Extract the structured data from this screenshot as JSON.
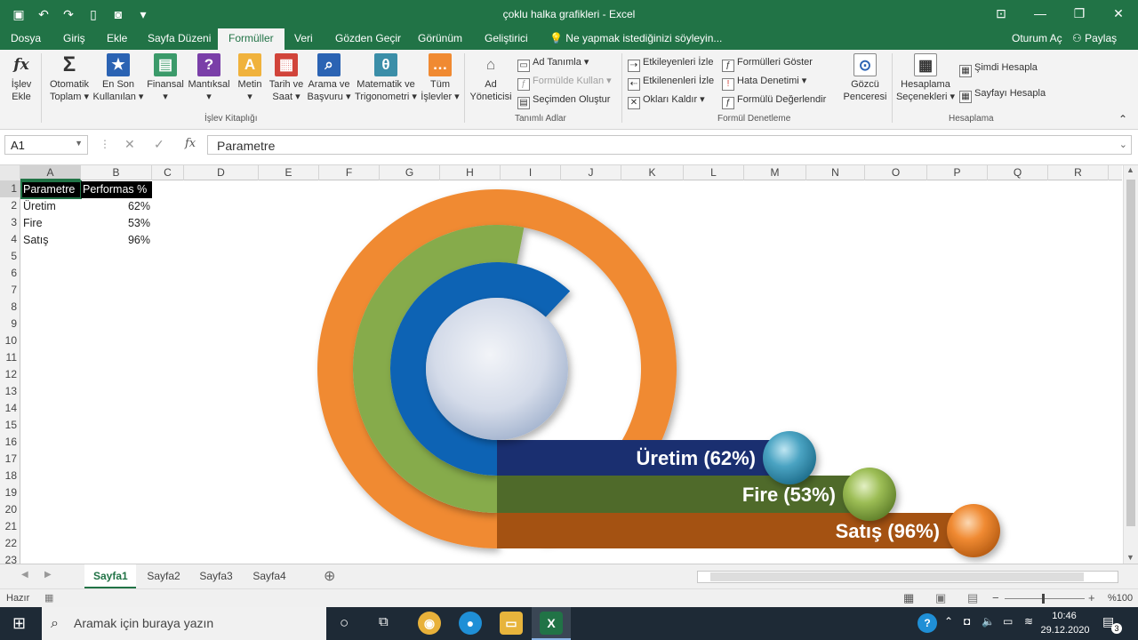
{
  "window": {
    "title": "çoklu halka grafikleri - Excel"
  },
  "tabs": [
    "Dosya",
    "Giriş",
    "Ekle",
    "Sayfa Düzeni",
    "Formüller",
    "Veri",
    "Gözden Geçir",
    "Görünüm",
    "Geliştirici"
  ],
  "tell_me": "Ne yapmak istediğinizi söyleyin...",
  "account": {
    "signin": "Oturum Aç",
    "share": "Paylaş"
  },
  "ribbon": {
    "big_buttons": [
      {
        "l1": "İşlev",
        "l2": "Ekle",
        "icon": "insert-function-icon"
      },
      {
        "l1": "Otomatik",
        "l2": "Toplam ▾",
        "icon": "autosum-icon"
      },
      {
        "l1": "En Son",
        "l2": "Kullanılan ▾",
        "icon": "recently-used-icon"
      },
      {
        "l1": "Finansal",
        "l2": "▾",
        "icon": "financial-icon"
      },
      {
        "l1": "Mantıksal",
        "l2": "▾",
        "icon": "logical-icon"
      },
      {
        "l1": "Metin",
        "l2": "▾",
        "icon": "text-icon"
      },
      {
        "l1": "Tarih ve",
        "l2": "Saat ▾",
        "icon": "date-time-icon"
      },
      {
        "l1": "Arama ve",
        "l2": "Başvuru ▾",
        "icon": "lookup-reference-icon"
      },
      {
        "l1": "Matematik ve",
        "l2": "Trigonometri ▾",
        "icon": "math-trig-icon"
      },
      {
        "l1": "Tüm",
        "l2": "İşlevler ▾",
        "icon": "more-functions-icon"
      },
      {
        "l1": "Ad",
        "l2": "Yöneticisi",
        "icon": "name-manager-icon"
      },
      {
        "l1": "Gözcü",
        "l2": "Penceresi",
        "icon": "watch-window-icon"
      },
      {
        "l1": "Hesaplama",
        "l2": "Seçenekleri ▾",
        "icon": "calculation-options-icon"
      }
    ],
    "defined_names": {
      "define": "Ad Tanımla ▾",
      "use": "Formülde Kullan ▾",
      "create": "Seçimden Oluştur"
    },
    "auditing": {
      "trace_prec": "Etkileyenleri İzle",
      "trace_dep": "Etkilenenleri İzle",
      "remove": "Okları Kaldır ▾",
      "show": "Formülleri Göster",
      "error": "Hata Denetimi ▾",
      "evaluate": "Formülü Değerlendir"
    },
    "calc": {
      "now": "Şimdi Hesapla",
      "sheet": "Sayfayı Hesapla"
    },
    "groups": {
      "library": "İşlev Kitaplığı",
      "names": "Tanımlı Adlar",
      "auditing": "Formül Denetleme",
      "calculation": "Hesaplama"
    }
  },
  "formula_bar": {
    "name_box": "A1",
    "fx": "fx",
    "content": "Parametre"
  },
  "columns": [
    "A",
    "B",
    "C",
    "D",
    "E",
    "F",
    "G",
    "H",
    "I",
    "J",
    "K",
    "L",
    "M",
    "N",
    "O",
    "P",
    "Q",
    "R"
  ],
  "rows": [
    "1",
    "2",
    "3",
    "4",
    "5",
    "6",
    "7",
    "8",
    "9",
    "10",
    "11",
    "12",
    "13",
    "14",
    "15",
    "16",
    "17",
    "18",
    "19",
    "20",
    "21",
    "22",
    "23"
  ],
  "cells": {
    "header": [
      "Parametre",
      "Performas %"
    ],
    "data": [
      [
        "Üretim",
        "62%"
      ],
      [
        "Fire",
        "53%"
      ],
      [
        "Satış",
        "96%"
      ]
    ]
  },
  "chart_data": {
    "type": "radial-bar",
    "categories": [
      "Üretim",
      "Fire",
      "Satış"
    ],
    "values": [
      62,
      53,
      96
    ],
    "labels": [
      "Üretim (62%)",
      "Fire (53%)",
      "Satış (96%)"
    ],
    "colors": [
      "#0f64b4",
      "#86ab4b",
      "#f08a32"
    ],
    "bar_colors": [
      "#1a2f70",
      "#4f6a2a",
      "#a45212"
    ]
  },
  "sheets": [
    "Sayfa1",
    "Sayfa2",
    "Sayfa3",
    "Sayfa4"
  ],
  "status": {
    "ready": "Hazır",
    "zoom": "%100"
  },
  "taskbar": {
    "search": "Aramak için buraya yazın",
    "time": "10:46",
    "date": "29.12.2020",
    "notif": "3"
  }
}
